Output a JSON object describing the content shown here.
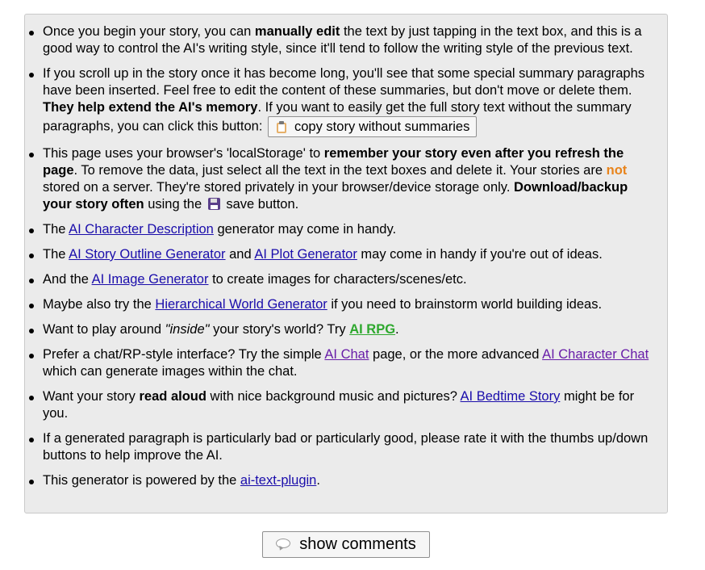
{
  "tips": {
    "t1": {
      "a": "Once you begin your story, you can ",
      "b": "manually edit",
      "c": " the text by just tapping in the text box, and this is a good way to control the AI's writing style, since it'll tend to follow the writing style of the previous text."
    },
    "t2": {
      "a": "If you scroll up in the story once it has become long, you'll see that some special summary paragraphs have been inserted. Feel free to edit the content of these summaries, but don't move or delete them. ",
      "b": "They help extend the AI's memory",
      "c": ". If you want to easily get the full story text without the summary paragraphs, you can click this button: ",
      "button_label": "copy story without summaries",
      "button_icon": "clipboard-icon"
    },
    "t3": {
      "a": "This page uses your browser's 'localStorage' to ",
      "b": "remember your story even after you refresh the page",
      "c": ". To remove the data, just select all the text in the text boxes and delete it. Your stories are ",
      "d": "not",
      "e": " stored on a server. They're stored privately in your browser/device storage only. ",
      "f": "Download/backup your story often",
      "g": " using the ",
      "icon": "floppy-disk-icon",
      "h": " save button."
    },
    "t4": {
      "a": "The ",
      "link": "AI Character Description",
      "b": " generator may come in handy."
    },
    "t5": {
      "a": "The ",
      "link1": "AI Story Outline Generator",
      "b": " and ",
      "link2": "AI Plot Generator",
      "c": " may come in handy if you're out of ideas."
    },
    "t6": {
      "a": "And the ",
      "link": "AI Image Generator",
      "b": " to create images for characters/scenes/etc."
    },
    "t7": {
      "a": "Maybe also try the ",
      "link": "Hierarchical World Generator",
      "b": " if you need to brainstorm world building ideas."
    },
    "t8": {
      "a": "Want to play around ",
      "em": "\"inside\"",
      "b": " your story's world? Try ",
      "link": "AI RPG",
      "c": "."
    },
    "t9": {
      "a": "Prefer a chat/RP-style interface? Try the simple ",
      "link1": "AI Chat",
      "b": " page, or the more advanced ",
      "link2": "AI Character Chat",
      "c": " which can generate images within the chat."
    },
    "t10": {
      "a": "Want your story ",
      "b": "read aloud",
      "c": " with nice background music and pictures? ",
      "link": "AI Bedtime Story",
      "d": " might be for you."
    },
    "t11": {
      "a": "If a generated paragraph is particularly bad or particularly good, please rate it with the thumbs up/down buttons to help improve the AI."
    },
    "t12": {
      "a": "This generator is powered by the ",
      "link": "ai-text-plugin",
      "b": "."
    }
  },
  "comments_button": {
    "label": "show comments",
    "icon": "speech-bubble-icon"
  },
  "colors": {
    "panel_bg": "#ebebeb",
    "link": "#1a0dab",
    "visited_link": "#681da8",
    "not_highlight": "#e8841c",
    "rpg_link": "#2ea82e"
  }
}
